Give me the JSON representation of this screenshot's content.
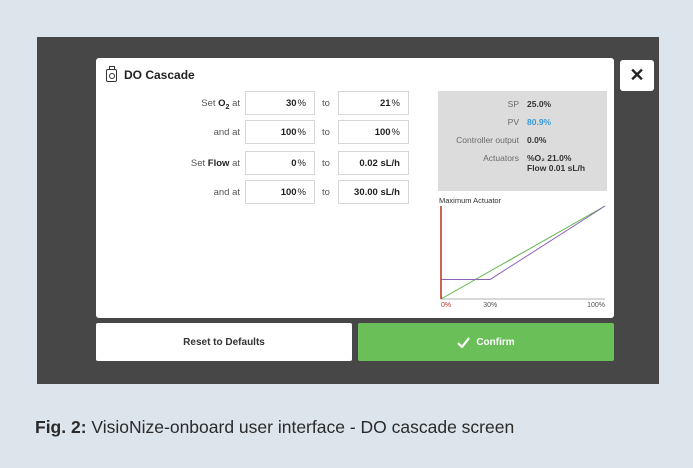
{
  "dialog": {
    "title": "DO Cascade",
    "close_label": "✕"
  },
  "rows": [
    {
      "label_pre": "Set ",
      "label_bold": "O",
      "label_sub": "2",
      "label_post": " at",
      "from_value": "30",
      "from_unit": "%",
      "to_label": "to",
      "to_value": "21",
      "to_unit": "%"
    },
    {
      "label_pre": "and at",
      "label_bold": "",
      "label_sub": "",
      "label_post": "",
      "from_value": "100",
      "from_unit": "%",
      "to_label": "to",
      "to_value": "100",
      "to_unit": "%"
    },
    {
      "label_pre": "Set ",
      "label_bold": "Flow",
      "label_sub": "",
      "label_post": " at",
      "from_value": "0",
      "from_unit": "%",
      "to_label": "to",
      "to_value": "0.02 sL/h",
      "to_unit": ""
    },
    {
      "label_pre": "and at",
      "label_bold": "",
      "label_sub": "",
      "label_post": "",
      "from_value": "100",
      "from_unit": "%",
      "to_label": "to",
      "to_value": "30.00 sL/h",
      "to_unit": ""
    }
  ],
  "status": {
    "sp_label": "SP",
    "sp_value": "25.0%",
    "pv_label": "PV",
    "pv_value": "80.9%",
    "co_label": "Controller output",
    "co_value": "0.0%",
    "act_label": "Actuators",
    "act_value_1": "%O₂ 21.0%",
    "act_value_2": "Flow 0.01 sL/h",
    "pv_color": "#3a9ad9"
  },
  "chart_data": {
    "type": "line",
    "title": "Maximum Actuator",
    "x_ticks": [
      "0%",
      "30%",
      "100%"
    ],
    "xlim": [
      0,
      100
    ],
    "ylim": [
      0,
      100
    ],
    "series": [
      {
        "color": "#5fb548",
        "x": [
          0,
          100
        ],
        "y": [
          0,
          100
        ]
      },
      {
        "color": "#8a63b8",
        "x": [
          0,
          30,
          100
        ],
        "y": [
          21,
          21,
          100
        ]
      },
      {
        "color": "#c0392b",
        "x": [
          0,
          0
        ],
        "y": [
          0,
          100
        ]
      }
    ]
  },
  "buttons": {
    "reset_label": "Reset to Defaults",
    "confirm_label": "Confirm",
    "confirm_color": "#6abf59"
  },
  "caption": {
    "prefix": "Fig. 2:",
    "text": " VisioNize-onboard user interface - DO cascade screen"
  }
}
